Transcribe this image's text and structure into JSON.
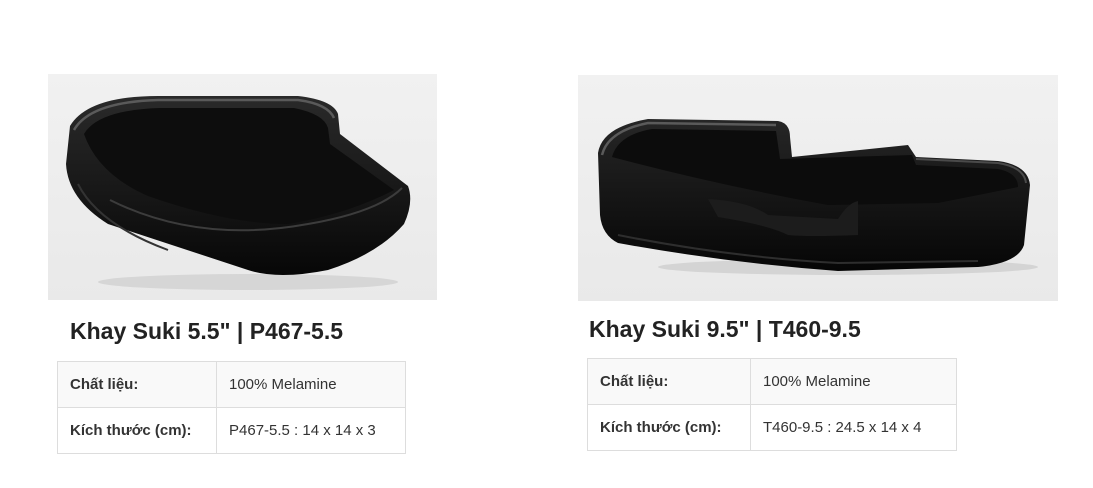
{
  "products": [
    {
      "title": "Khay Suki 5.5\" | P467-5.5",
      "image": {
        "subject": "black-melamine-square-tray",
        "color": "#111111"
      },
      "specs": [
        {
          "label": "Chất liệu:",
          "value": "100% Melamine"
        },
        {
          "label": "Kích thước (cm):",
          "value": "P467-5.5 : 14 x 14 x 3"
        }
      ]
    },
    {
      "title": "Khay Suki 9.5\" | T460-9.5",
      "image": {
        "subject": "black-melamine-rectangular-tray",
        "color": "#111111"
      },
      "specs": [
        {
          "label": "Chất liệu:",
          "value": "100% Melamine"
        },
        {
          "label": "Kích thước (cm):",
          "value": "T460-9.5 : 24.5 x 14 x 4"
        }
      ]
    }
  ]
}
